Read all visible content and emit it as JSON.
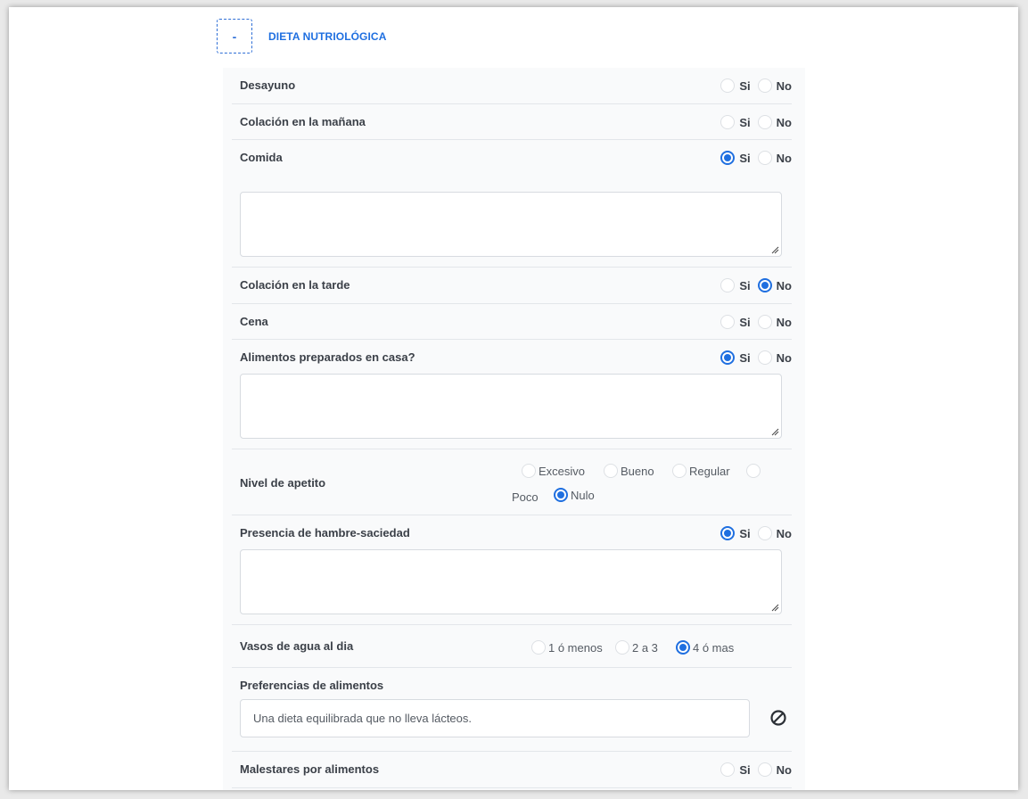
{
  "section": {
    "toggle_label": "-",
    "title": "DIETA NUTRIOLÓGICA"
  },
  "colors": {
    "accent": "#1f6fe0",
    "panel_bg": "#f9fafb",
    "text": "#3b4048"
  },
  "rows": {
    "desayuno": {
      "label": "Desayuno",
      "yes": "Si",
      "no": "No",
      "selected": "none"
    },
    "colacion_manana": {
      "label": "Colación en la mañana",
      "yes": "Si",
      "no": "No",
      "selected": "none"
    },
    "comida": {
      "label": "Comida",
      "yes": "Si",
      "no": "No",
      "selected": "yes",
      "text_value": ""
    },
    "colacion_tarde": {
      "label": "Colación en la tarde",
      "yes": "Si",
      "no": "No",
      "selected": "no"
    },
    "cena": {
      "label": "Cena",
      "yes": "Si",
      "no": "No",
      "selected": "none"
    },
    "alimentos_casa": {
      "label": "Alimentos preparados en casa?",
      "yes": "Si",
      "no": "No",
      "selected": "yes",
      "text_value": ""
    },
    "nivel_apetito": {
      "label": "Nivel de apetito",
      "options": [
        "Excesivo",
        "Bueno",
        "Regular",
        "Poco",
        "Nulo"
      ],
      "selected": "Nulo"
    },
    "hambre_saciedad": {
      "label": "Presencia de hambre-saciedad",
      "yes": "Si",
      "no": "No",
      "selected": "yes",
      "text_value": ""
    },
    "vasos_agua": {
      "label": "Vasos de agua al dia",
      "options": [
        "1 ó menos",
        "2 a 3",
        "4 ó mas"
      ],
      "selected": "4 ó mas"
    },
    "preferencias": {
      "label": "Preferencias de alimentos",
      "placeholder": "Una dieta equilibrada que no lleva lácteos.",
      "clear_icon": "ban-icon"
    },
    "malestares": {
      "label": "Malestares por alimentos",
      "yes": "Si",
      "no": "No",
      "selected": "none"
    }
  }
}
